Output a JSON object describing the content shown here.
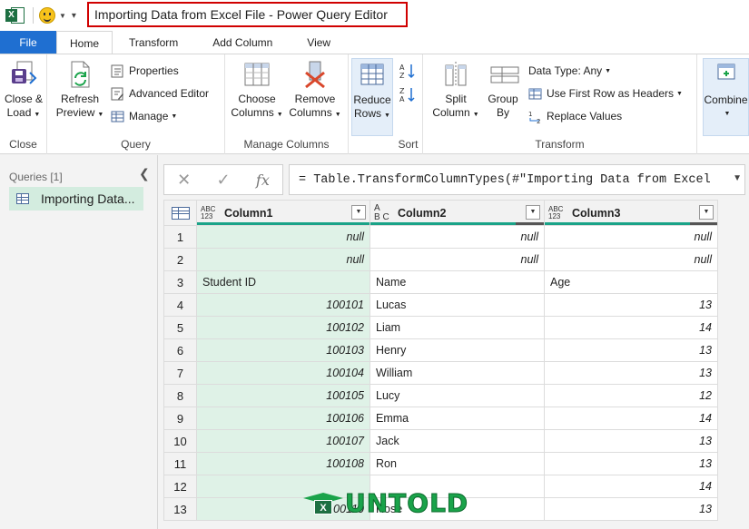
{
  "window": {
    "title": "Importing Data from Excel File - Power Query Editor"
  },
  "tabs": [
    {
      "label": "File"
    },
    {
      "label": "Home"
    },
    {
      "label": "Transform"
    },
    {
      "label": "Add Column"
    },
    {
      "label": "View"
    }
  ],
  "ribbon": {
    "close": {
      "label": "Close &",
      "label2": "Load",
      "group": "Close"
    },
    "query": {
      "refresh_label": "Refresh",
      "refresh_label2": "Preview",
      "properties": "Properties",
      "advanced_editor": "Advanced Editor",
      "manage": "Manage",
      "group": "Query"
    },
    "manage_columns": {
      "choose_label": "Choose",
      "choose_label2": "Columns",
      "remove_label": "Remove",
      "remove_label2": "Columns",
      "group": "Manage Columns"
    },
    "reduce": {
      "label": "Reduce",
      "label2": "Rows"
    },
    "sort": {
      "group": "Sort"
    },
    "transform": {
      "split_label": "Split",
      "split_label2": "Column",
      "group_label": "Group",
      "group_label2": "By",
      "data_type": "Data Type: Any",
      "first_row": "Use First Row as Headers",
      "replace": "Replace Values",
      "group": "Transform"
    },
    "combine": {
      "label": "Combine"
    }
  },
  "queries": {
    "header": "Queries [1]",
    "items": [
      {
        "label": "Importing Data..."
      }
    ]
  },
  "formula": {
    "text": "= Table.TransformColumnTypes(#\"Importing Data from Excel"
  },
  "grid": {
    "columns": [
      {
        "type_top": "ABC",
        "type_bottom": "123",
        "name": "Column1"
      },
      {
        "type_top": "A",
        "type_bottom": "B C",
        "name": "Column2"
      },
      {
        "type_top": "ABC",
        "type_bottom": "123",
        "name": "Column3"
      }
    ],
    "rows": [
      [
        "1",
        "null",
        "null",
        "null"
      ],
      [
        "2",
        "null",
        "null",
        "null"
      ],
      [
        "3",
        "Student ID",
        "Name",
        "Age"
      ],
      [
        "4",
        "100101",
        "Lucas",
        "13"
      ],
      [
        "5",
        "100102",
        "Liam",
        "14"
      ],
      [
        "6",
        "100103",
        "Henry",
        "13"
      ],
      [
        "7",
        "100104",
        "William",
        "13"
      ],
      [
        "8",
        "100105",
        "Lucy",
        "12"
      ],
      [
        "9",
        "100106",
        "Emma",
        "14"
      ],
      [
        "10",
        "100107",
        "Jack",
        "13"
      ],
      [
        "11",
        "100108",
        "Ron",
        "13"
      ],
      [
        "12",
        "",
        "",
        "14"
      ],
      [
        "13",
        "100110",
        "Rose",
        "13"
      ]
    ]
  },
  "watermark": {
    "text": "UNTOLD",
    "badge": "X"
  },
  "colors": {
    "file_tab": "#1f6fd1",
    "column1_fill": "#dff2e7",
    "quality_bar": "#1aa388",
    "title_border": "#d00000"
  }
}
